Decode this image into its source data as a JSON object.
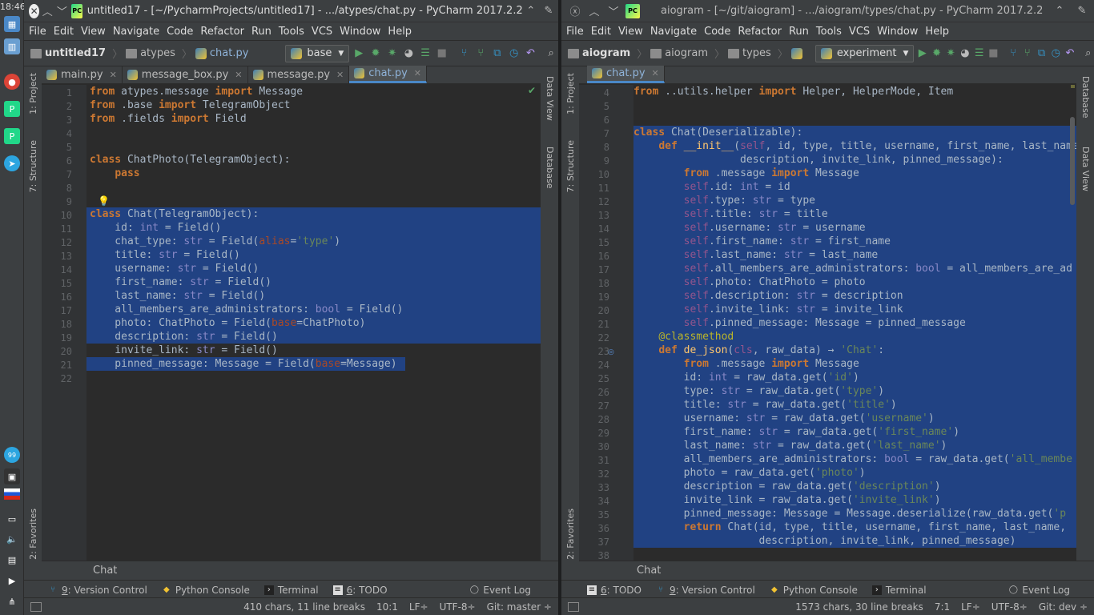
{
  "dock": {
    "clock": "18:46",
    "badge": "99"
  },
  "left": {
    "title": "untitled17 - [~/PycharmProjects/untitled17] - .../atypes/chat.py - PyCharm 2017.2.2",
    "menu": [
      "File",
      "Edit",
      "View",
      "Navigate",
      "Code",
      "Refactor",
      "Run",
      "Tools",
      "VCS",
      "Window",
      "Help"
    ],
    "breadcrumbs": [
      "untitled17",
      "atypes",
      "chat.py"
    ],
    "run_config": "base",
    "tabs": [
      {
        "label": "main.py",
        "active": false
      },
      {
        "label": "message_box.py",
        "active": false
      },
      {
        "label": "message.py",
        "active": false
      },
      {
        "label": "chat.py",
        "active": true
      }
    ],
    "side_left": [
      "1: Project",
      "7: Structure",
      "2: Favorites"
    ],
    "side_right": [
      "Data View",
      "Database"
    ],
    "line_start": 1,
    "code_lines": [
      "<span class='kw'>from</span> atypes.message <span class='kw'>import</span> Message",
      "<span class='kw'>from</span> .base <span class='kw'>import</span> TelegramObject",
      "<span class='kw'>from</span> .fields <span class='kw'>import</span> Field",
      "",
      "",
      "<span class='kw'>class</span> ChatPhoto(TelegramObject):",
      "    <span class='kw'>pass</span>",
      "",
      "",
      "<span class='kw'>class</span> Chat(TelegramObject):",
      "    id: <span class='bi'>int</span> = Field()",
      "    chat_type: <span class='bi'>str</span> = Field(<span class='pr'>alias</span>=<span class='st'>'type'</span>)",
      "    title: <span class='bi'>str</span> = Field()",
      "    username: <span class='bi'>str</span> = Field()",
      "    first_name: <span class='bi'>str</span> = Field()",
      "    last_name: <span class='bi'>str</span> = Field()",
      "    all_members_are_administrators: <span class='bi'>bool</span> = Field()",
      "    photo: ChatPhoto = Field(<span class='pr'>base</span>=ChatPhoto)",
      "    description: <span class='bi'>str</span> = Field()",
      "    invite_link: <span class='bi'>str</span> = Field()",
      "    pinned_message: Message = Field(<span class='pr'>base</span>=Message)",
      ""
    ],
    "structure_label": "Chat",
    "tool_tabs": [
      {
        "num": "9",
        "label": "Version Control"
      },
      {
        "num": "",
        "label": "Python Console"
      },
      {
        "num": "",
        "label": "Terminal"
      },
      {
        "num": "6",
        "label": "TODO"
      }
    ],
    "event_log": "Event Log",
    "status": {
      "chars": "410 chars, 11 line breaks",
      "pos": "10:1",
      "lf": "LF÷",
      "enc": "UTF-8÷",
      "git": "Git: master ÷"
    }
  },
  "right": {
    "title": "aiogram - [~/git/aiogram] - .../aiogram/types/chat.py - PyCharm 2017.2.2",
    "menu": [
      "File",
      "Edit",
      "View",
      "Navigate",
      "Code",
      "Refactor",
      "Run",
      "Tools",
      "VCS",
      "Window",
      "Help"
    ],
    "breadcrumbs": [
      "aiogram",
      "aiogram",
      "types"
    ],
    "run_config": "experiment",
    "tabs": [
      {
        "label": "chat.py",
        "active": true
      }
    ],
    "side_left": [
      "1: Project",
      "7: Structure",
      "2: Favorites"
    ],
    "side_right": [
      "Database",
      "Data View"
    ],
    "line_start": 4,
    "code_lines": [
      "<span class='kw'>from</span> ..utils.helper <span class='kw'>import</span> Helper, HelperMode, Item",
      "",
      "",
      "<span class='kw'>class</span> Chat(Deserializable):",
      "    <span class='kw'>def</span> <span class='fn'>__init__</span>(<span class='sf'>self</span>, id, type, title, username, first_name, last_name,",
      "                 description, invite_link, pinned_message):",
      "        <span class='kw'>from</span> .message <span class='kw'>import</span> Message",
      "        <span class='sf'>self</span>.id: <span class='bi'>int</span> = id",
      "        <span class='sf'>self</span>.type: <span class='bi'>str</span> = type",
      "        <span class='sf'>self</span>.title: <span class='bi'>str</span> = title",
      "        <span class='sf'>self</span>.username: <span class='bi'>str</span> = username",
      "        <span class='sf'>self</span>.first_name: <span class='bi'>str</span> = first_name",
      "        <span class='sf'>self</span>.last_name: <span class='bi'>str</span> = last_name",
      "        <span class='sf'>self</span>.all_members_are_administrators: <span class='bi'>bool</span> = all_members_are_ad",
      "        <span class='sf'>self</span>.photo: ChatPhoto = photo",
      "        <span class='sf'>self</span>.description: <span class='bi'>str</span> = description",
      "        <span class='sf'>self</span>.invite_link: <span class='bi'>str</span> = invite_link",
      "        <span class='sf'>self</span>.pinned_message: Message = pinned_message",
      "    <span class='dc'>@classmethod</span>",
      "    <span class='kw'>def</span> <span class='fn'>de_json</span>(<span class='sf'>cls</span>, raw_data) → <span class='st'>'Chat'</span>:",
      "        <span class='kw'>from</span> .message <span class='kw'>import</span> Message",
      "        id: <span class='bi'>int</span> = raw_data.get(<span class='st'>'id'</span>)",
      "        type: <span class='bi'>str</span> = raw_data.get(<span class='st'>'type'</span>)",
      "        title: <span class='bi'>str</span> = raw_data.get(<span class='st'>'title'</span>)",
      "        username: <span class='bi'>str</span> = raw_data.get(<span class='st'>'username'</span>)",
      "        first_name: <span class='bi'>str</span> = raw_data.get(<span class='st'>'first_name'</span>)",
      "        last_name: <span class='bi'>str</span> = raw_data.get(<span class='st'>'last_name'</span>)",
      "        all_members_are_administrators: <span class='bi'>bool</span> = raw_data.get(<span class='st'>'all_membe</span>",
      "        photo = raw_data.get(<span class='st'>'photo'</span>)",
      "        description = raw_data.get(<span class='st'>'description'</span>)",
      "        invite_link = raw_data.get(<span class='st'>'invite_link'</span>)",
      "        pinned_message: Message = Message.deserialize(raw_data.get(<span class='st'>'p</span>",
      "        <span class='kw'>return</span> Chat(id, type, title, username, first_name, last_name,",
      "                    description, invite_link, pinned_message)",
      ""
    ],
    "structure_label": "Chat",
    "tool_tabs": [
      {
        "num": "6",
        "label": "TODO"
      },
      {
        "num": "9",
        "label": "Version Control"
      },
      {
        "num": "",
        "label": "Python Console"
      },
      {
        "num": "",
        "label": "Terminal"
      }
    ],
    "event_log": "Event Log",
    "status": {
      "chars": "1573 chars, 30 line breaks",
      "pos": "7:1",
      "lf": "LF÷",
      "enc": "UTF-8÷",
      "git": "Git: dev ÷"
    }
  }
}
